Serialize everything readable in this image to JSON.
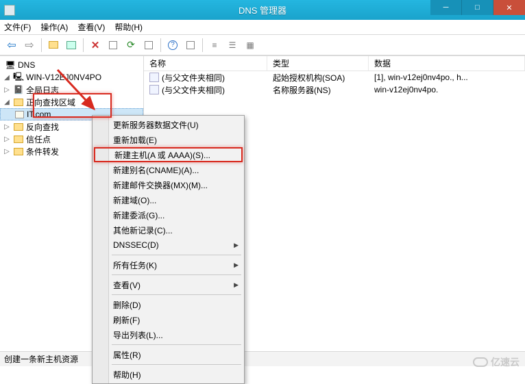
{
  "title": "DNS 管理器",
  "menubar": [
    "文件(F)",
    "操作(A)",
    "查看(V)",
    "帮助(H)"
  ],
  "tree": {
    "root": "DNS",
    "server": "WIN-V12EJ0NV4PO",
    "nodes": {
      "global_log": "全局日志",
      "fwd_zone": "正向查找区域",
      "selected_zone": "IT.com",
      "rev_zone": "反向查找",
      "trust": "信任点",
      "cond": "条件转发"
    }
  },
  "list": {
    "cols": {
      "name": "名称",
      "type": "类型",
      "data": "数据"
    },
    "rows": [
      {
        "name": "(与父文件夹相同)",
        "type": "起始授权机构(SOA)",
        "data": "[1], win-v12ej0nv4po., h..."
      },
      {
        "name": "(与父文件夹相同)",
        "type": "名称服务器(NS)",
        "data": "win-v12ej0nv4po."
      }
    ]
  },
  "ctx": [
    {
      "id": "update",
      "label": "更新服务器数据文件(U)"
    },
    {
      "id": "reload",
      "label": "重新加载(E)"
    },
    {
      "id": "newhost",
      "label": "新建主机(A 或 AAAA)(S)...",
      "hl": true
    },
    {
      "id": "newcname",
      "label": "新建别名(CNAME)(A)..."
    },
    {
      "id": "newmx",
      "label": "新建邮件交换器(MX)(M)..."
    },
    {
      "id": "newdomain",
      "label": "新建域(O)..."
    },
    {
      "id": "newdeleg",
      "label": "新建委派(G)..."
    },
    {
      "id": "otherrec",
      "label": "其他新记录(C)..."
    },
    {
      "id": "dnssec",
      "label": "DNSSEC(D)",
      "sub": true
    },
    {
      "sep": true
    },
    {
      "id": "alltasks",
      "label": "所有任务(K)",
      "sub": true
    },
    {
      "sep": true
    },
    {
      "id": "view",
      "label": "查看(V)",
      "sub": true
    },
    {
      "sep": true
    },
    {
      "id": "delete",
      "label": "删除(D)"
    },
    {
      "id": "refresh",
      "label": "刷新(F)"
    },
    {
      "id": "export",
      "label": "导出列表(L)..."
    },
    {
      "sep": true
    },
    {
      "id": "props",
      "label": "属性(R)"
    },
    {
      "sep": true
    },
    {
      "id": "help",
      "label": "帮助(H)"
    }
  ],
  "status": "创建一条新主机资源",
  "watermark": "亿速云"
}
